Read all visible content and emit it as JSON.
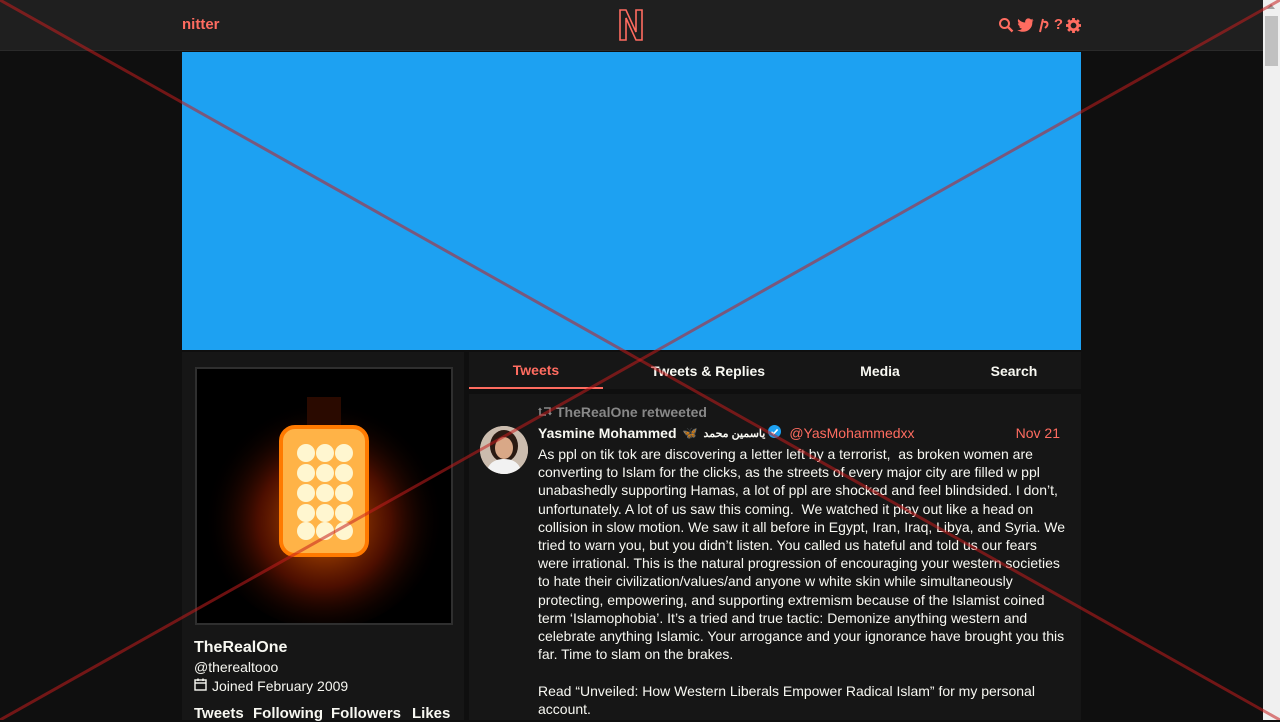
{
  "nav": {
    "brand": "nitter",
    "logo_letter": "N",
    "icons": [
      "search-icon",
      "twitter-icon",
      "rss-icon",
      "help-icon",
      "gear-icon"
    ],
    "accent": "#ff6c60"
  },
  "banner": {
    "color": "#1da1f2"
  },
  "profile": {
    "fullname": "TheRealOne",
    "username": "@therealtooo",
    "joined": "Joined February 2009",
    "stats": [
      "Tweets",
      "Following",
      "Followers",
      "Likes"
    ]
  },
  "tabs": [
    "Tweets",
    "Tweets & Replies",
    "Media",
    "Search"
  ],
  "tweet": {
    "retweet_header": "TheRealOne retweeted",
    "fullname": "Yasmine Mohammed",
    "emoji": "🦋",
    "arabic_name": "ياسمين محمد",
    "username": "@YasMohammedxx",
    "date": "Nov 21",
    "body": "As ppl on tik tok are discovering a letter left by a terrorist,  as broken women are converting to Islam for the clicks, as the streets of every major city are filled w ppl unabashedly supporting Hamas, a lot of ppl are shocked and feel blindsided. I don’t, unfortunately. A lot of us saw this coming.  We watched it play out like a head on collision in slow motion. We saw it all before in Egypt, Iran, Iraq, Libya, and Syria. We tried to warn you, but you didn’t listen. You called us hateful and told us our fears were irrational. This is the natural progression of encouraging your western societies to hate their civilization/values/and anyone w white skin while simultaneously protecting, empowering, and supporting extremism because of the Islamist coined term ‘Islamophobia’. It’s a tried and true tactic: Demonize anything western and celebrate anything Islamic. Your arrogance and your ignorance have brought you this far. Time to slam on the brakes.\n\nRead “Unveiled: How Western Liberals Empower Radical Islam” for my personal account."
  }
}
